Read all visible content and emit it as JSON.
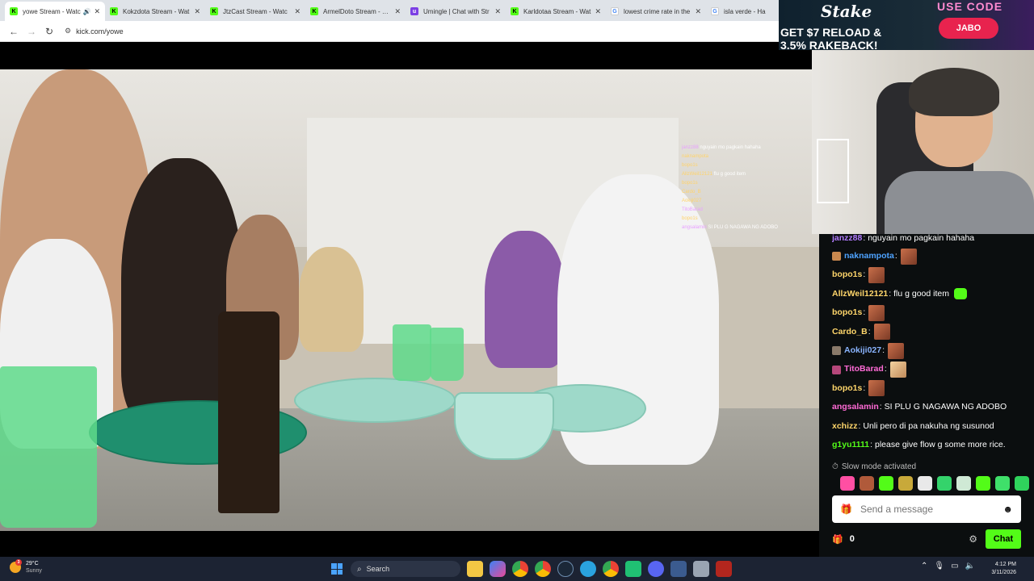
{
  "browser": {
    "tabs": [
      {
        "title": "yowe Stream - Watc",
        "icon": "kick-icon",
        "active": true,
        "audio": true
      },
      {
        "title": "Kokzdota Stream - Wat",
        "icon": "kick-icon"
      },
      {
        "title": "JtzCast Stream - Watc",
        "icon": "kick-icon"
      },
      {
        "title": "ArmelDoto Stream - Wa",
        "icon": "kick-icon"
      },
      {
        "title": "Umingle | Chat with Str",
        "icon": "umingle-icon"
      },
      {
        "title": "Karldotaa Stream - Wat",
        "icon": "kick-icon"
      },
      {
        "title": "lowest crime rate in the",
        "icon": "google-icon"
      },
      {
        "title": "isla verde - Ha",
        "icon": "google-icon"
      }
    ],
    "url": "kick.com/yowe"
  },
  "ad": {
    "brand": "Stake",
    "promo_line1": "GET $7 RELOAD &",
    "promo_line2": "3.5% RAKEBACK!",
    "use_code": "USE CODE",
    "code": "JABO"
  },
  "overlay_chat": [
    {
      "user": "janzz88",
      "text": "nguyain mo pagkain hahaha"
    },
    {
      "user": "naknampota",
      "text": ""
    },
    {
      "user": "bopo1s",
      "text": ""
    },
    {
      "user": "AllzWeil12121",
      "text": "flu g good item"
    },
    {
      "user": "bopo1s",
      "text": ""
    },
    {
      "user": "Cardo_B",
      "text": ""
    },
    {
      "user": "Aokiji027",
      "text": ""
    },
    {
      "user": "TitoBarad",
      "text": ""
    },
    {
      "user": "bopo1s",
      "text": ""
    },
    {
      "user": "angsalamin",
      "text": "SI PLU G NAGAWA NG ADOBO"
    }
  ],
  "chat": {
    "messages": [
      {
        "user": "janzz88",
        "color": "#b27cff",
        "text": "nguyain mo pagkain hahaha",
        "emote": false
      },
      {
        "user": "naknampota",
        "color": "#4ea3ff",
        "text": "",
        "emote": true
      },
      {
        "user": "bopo1s",
        "color": "#ffd66b",
        "text": "",
        "emote": true
      },
      {
        "user": "AllzWeil12121",
        "color": "#ffd66b",
        "text": "flu g good item",
        "emote": false
      },
      {
        "user": "bopo1s",
        "color": "#ffd66b",
        "text": "",
        "emote": true
      },
      {
        "user": "Cardo_B",
        "color": "#ffd66b",
        "text": "",
        "emote": true
      },
      {
        "user": "Aokiji027",
        "color": "#8ab4ff",
        "text": "",
        "emote": true
      },
      {
        "user": "TitoBarad",
        "color": "#ff6bd6",
        "text": "",
        "emote": true
      },
      {
        "user": "bopo1s",
        "color": "#ffd66b",
        "text": "",
        "emote": true
      },
      {
        "user": "angsalamin",
        "color": "#ff6bd6",
        "text": "SI PLU G NAGAWA NG ADOBO",
        "emote": false
      },
      {
        "user": "xchizz",
        "color": "#ffd66b",
        "text": "Unli pero di pa nakuha ng susunod",
        "emote": false
      },
      {
        "user": "g1yu1111",
        "color": "#53fc18",
        "text": "please give flow g some more rice.",
        "emote": false
      }
    ],
    "slow_mode": "Slow mode activated",
    "placeholder": "Send a message",
    "points": "0",
    "chat_button": "Chat"
  },
  "taskbar": {
    "weather_temp": "29°C",
    "weather_desc": "Sunny",
    "weather_badge": "3",
    "search_label": "Search",
    "time": "4:12 PM",
    "date": "3/11/2026"
  }
}
